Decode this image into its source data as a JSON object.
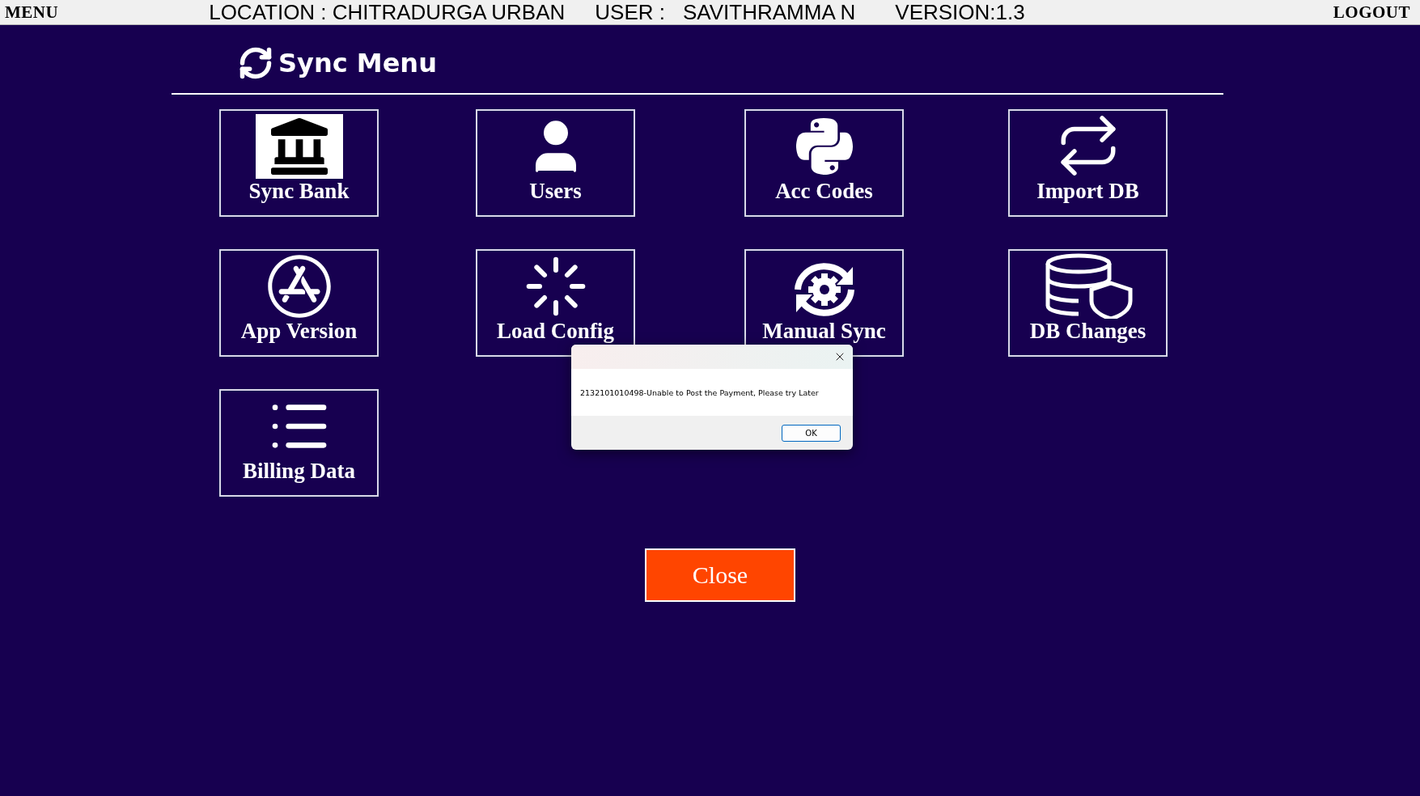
{
  "top_bar": {
    "menu": "MENU",
    "location": "LOCATION : CHITRADURGA URBAN",
    "user_label": "USER :",
    "user": "SAVITHRAMMA N",
    "version": "VERSION:1.3",
    "logout": "LOGOUT"
  },
  "title": "Sync Menu",
  "tiles": [
    {
      "label": "Sync Bank"
    },
    {
      "label": "Users"
    },
    {
      "label": "Acc Codes"
    },
    {
      "label": "Import DB"
    },
    {
      "label": "App Version"
    },
    {
      "label": "Load Config"
    },
    {
      "label": "Manual Sync"
    },
    {
      "label": "DB Changes"
    },
    {
      "label": "Billing Data"
    }
  ],
  "close_button": "Close",
  "dialog": {
    "message": "2132101010498-Unable to Post the Payment, Please try Later",
    "ok_button": "OK"
  }
}
